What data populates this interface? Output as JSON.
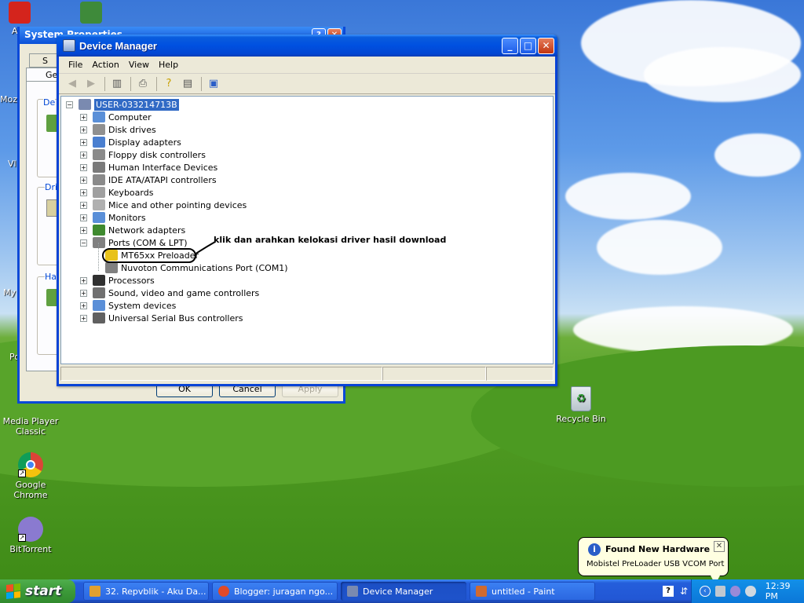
{
  "desktop": {
    "icons_left_top": [
      {
        "label": "Adc"
      },
      {
        "label": "Moz"
      },
      {
        "label": "Vl"
      },
      {
        "label": "My"
      },
      {
        "label": "Po"
      }
    ],
    "icons": [
      {
        "label": "Media Player Classic"
      },
      {
        "label": "Google Chrome"
      },
      {
        "label": "BitTorrent"
      },
      {
        "label": "Recycle Bin"
      }
    ]
  },
  "system_properties": {
    "title": "System Properties",
    "tab1": "S",
    "tab2": "Ge",
    "group1": "De",
    "group2": "Driv",
    "group3": "Har",
    "ok": "OK",
    "cancel": "Cancel",
    "apply": "Apply"
  },
  "device_manager": {
    "title": "Device Manager",
    "menu": [
      "File",
      "Action",
      "View",
      "Help"
    ],
    "root": "USER-033214713B",
    "nodes": [
      {
        "label": "Computer",
        "exp": "+",
        "color": "#5a8fd8"
      },
      {
        "label": "Disk drives",
        "exp": "+",
        "color": "#909090"
      },
      {
        "label": "Display adapters",
        "exp": "+",
        "color": "#4a7fd0"
      },
      {
        "label": "Floppy disk controllers",
        "exp": "+",
        "color": "#8a8a8a"
      },
      {
        "label": "Human Interface Devices",
        "exp": "+",
        "color": "#7a7a7a"
      },
      {
        "label": "IDE ATA/ATAPI controllers",
        "exp": "+",
        "color": "#8a8a8a"
      },
      {
        "label": "Keyboards",
        "exp": "+",
        "color": "#a0a0a0"
      },
      {
        "label": "Mice and other pointing devices",
        "exp": "+",
        "color": "#b0b0b0"
      },
      {
        "label": "Monitors",
        "exp": "+",
        "color": "#5a8fd8"
      },
      {
        "label": "Network adapters",
        "exp": "+",
        "color": "#3f8a2f"
      },
      {
        "label": "Ports (COM & LPT)",
        "exp": "-",
        "color": "#808080"
      },
      {
        "label": "MT65xx Preloader",
        "child": true,
        "color": "#e8c21a"
      },
      {
        "label": "Nuvoton Communications Port (COM1)",
        "child": true,
        "color": "#808080"
      },
      {
        "label": "Processors",
        "exp": "+",
        "color": "#303030"
      },
      {
        "label": "Sound, video and game controllers",
        "exp": "+",
        "color": "#707070"
      },
      {
        "label": "System devices",
        "exp": "+",
        "color": "#5a8fd8"
      },
      {
        "label": "Universal Serial Bus controllers",
        "exp": "+",
        "color": "#606060"
      }
    ],
    "annotation": "klik dan arahkan kelokasi driver hasil download"
  },
  "balloon": {
    "title": "Found New Hardware",
    "message": "Mobistel PreLoader USB VCOM Port"
  },
  "taskbar": {
    "start": "start",
    "tasks": [
      {
        "label": "32. Repvblik - Aku Da...",
        "color": "#e0a030"
      },
      {
        "label": "Blogger: juragan ngo...",
        "color": "#e04a2a"
      },
      {
        "label": "Device Manager",
        "color": "#7a8ab0"
      },
      {
        "label": "untitled - Paint",
        "color": "#d06a30"
      }
    ],
    "clock": "12:39 PM"
  }
}
